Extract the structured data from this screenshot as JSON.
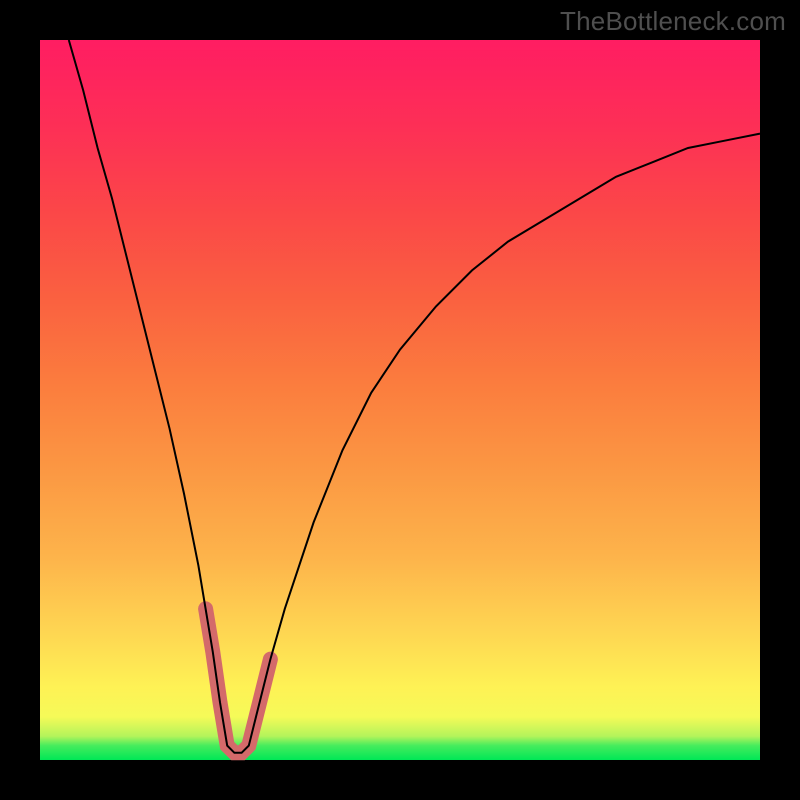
{
  "watermark": "TheBottleneck.com",
  "chart_data": {
    "type": "line",
    "title": "",
    "xlabel": "",
    "ylabel": "",
    "xlim": [
      0,
      100
    ],
    "ylim": [
      0,
      100
    ],
    "series": [
      {
        "name": "bottleneck-curve",
        "x": [
          4,
          6,
          8,
          10,
          12,
          14,
          16,
          18,
          20,
          22,
          23,
          24,
          25,
          26,
          27,
          28,
          29,
          30,
          32,
          34,
          38,
          42,
          46,
          50,
          55,
          60,
          65,
          70,
          75,
          80,
          85,
          90,
          95,
          100
        ],
        "values": [
          100,
          93,
          85,
          78,
          70,
          62,
          54,
          46,
          37,
          27,
          21,
          15,
          8,
          2,
          1,
          1,
          2,
          6,
          14,
          21,
          33,
          43,
          51,
          57,
          63,
          68,
          72,
          75,
          78,
          81,
          83,
          85,
          86,
          87
        ]
      },
      {
        "name": "highlight-bottom",
        "x": [
          23,
          24,
          25,
          26,
          27,
          28,
          29,
          30,
          31,
          32
        ],
        "values": [
          21,
          15,
          8,
          2,
          1,
          1,
          2,
          6,
          10,
          14
        ]
      }
    ],
    "grid": false,
    "legend": false,
    "background_gradient": {
      "top": "#ff1d62",
      "mid": "#fed552",
      "bottom": "#00e756"
    }
  }
}
